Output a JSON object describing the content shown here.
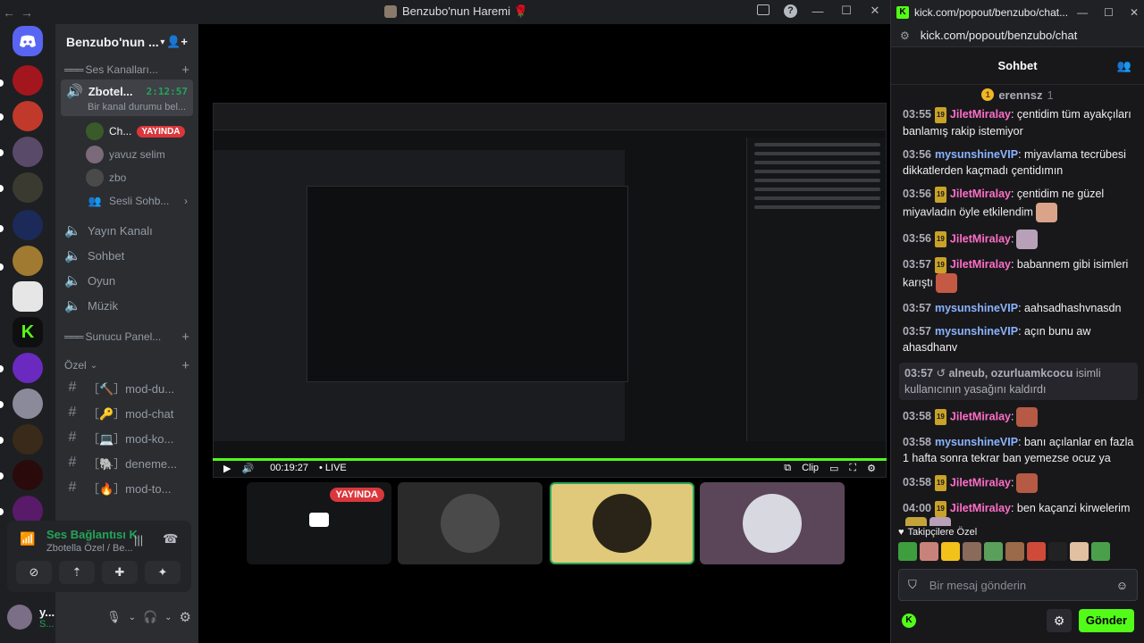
{
  "discord": {
    "window_title": "Benzubo'nun Haremi 🌹",
    "guild_name": "Benzubo'nun ...",
    "categories": {
      "voice": "Ses Kanalları...",
      "server_panel": "Sunucu Panel...",
      "private": "Özel"
    },
    "active_channel": {
      "name": "Zbotel...",
      "timer": "2:12:57",
      "status": "Bir kanal durumu bel..."
    },
    "members": [
      {
        "name": "Ch...",
        "badge": "YAYINDA"
      },
      {
        "name": "yavuz selim"
      },
      {
        "name": "zbo"
      }
    ],
    "subchannel": "Sesli Sohb...",
    "voice_channels": [
      "Yayın Kanalı",
      "Sohbet",
      "Oyun",
      "Müzik"
    ],
    "text_channels": [
      "［🔨］mod-du...",
      "［🔑］mod-chat",
      "［💻］mod-ko...",
      "［🐘］deneme...",
      "［🔥］mod-to..."
    ],
    "voice_panel": {
      "title": "Ses Bağlantısı K",
      "subtitle": "Zbotella Özel / Be..."
    },
    "user": {
      "name": "y...",
      "status": "S..."
    },
    "stream": {
      "time": "00:19:27",
      "live_label": "• LIVE",
      "clip_label": "Clip"
    },
    "tiles": {
      "live_label": "YAYINDA"
    }
  },
  "kick": {
    "window_title": "kick.com/popout/benzubo/chat...",
    "url": "kick.com/popout/benzubo/chat",
    "header": "Sohbet",
    "pinned_user": "erennsz",
    "pinned_count": "1",
    "messages": [
      {
        "ts": "03:55",
        "badge": "19",
        "user": "JiletMiralay",
        "color": "pink",
        "text": ": çentidim tüm ayakçıları banlamış rakip istemiyor"
      },
      {
        "ts": "03:56",
        "user": "mysunshineVIP",
        "color": "blue",
        "text": ": miyavlama tecrübesi dikkatlerden kaçmadı çentidımın"
      },
      {
        "ts": "03:56",
        "badge": "19",
        "user": "JiletMiralay",
        "color": "pink",
        "text": ": çentidim ne güzel miyavladın öyle etkilendim",
        "emote": "#d9a48a"
      },
      {
        "ts": "03:56",
        "badge": "19",
        "user": "JiletMiralay",
        "color": "pink",
        "text": ":",
        "emote": "#b8a0b8"
      },
      {
        "ts": "03:57",
        "badge": "19",
        "user": "JiletMiralay",
        "color": "pink",
        "text": ": babannem gibi isimleri karıştı",
        "emote": "#c55a44"
      },
      {
        "ts": "03:57",
        "user": "mysunshineVIP",
        "color": "blue",
        "text": ": aahsadhashvnasdn"
      },
      {
        "ts": "03:57",
        "user": "mysunshineVIP",
        "color": "blue",
        "text": ": açın bunu aw ahasdhanv"
      }
    ],
    "system_message": {
      "ts": "03:57",
      "users": "alneub, ozurluamkcocu",
      "text": " isimli kullanıcının yasağını kaldırdı"
    },
    "messages2": [
      {
        "ts": "03:58",
        "badge": "19",
        "user": "JiletMiralay",
        "color": "pink",
        "text": ":",
        "emote": "#b45a45"
      },
      {
        "ts": "03:58",
        "user": "mysunshineVIP",
        "color": "blue",
        "text": ": banı açılanlar en fazla 1 hafta sonra tekrar ban yemezse ocuz ya"
      },
      {
        "ts": "03:58",
        "badge": "19",
        "user": "JiletMiralay",
        "color": "pink",
        "text": ":",
        "emote": "#b45a45"
      },
      {
        "ts": "04:00",
        "badge": "19",
        "user": "JiletMiralay",
        "color": "pink",
        "text": ": ben kaçanzi kirwelerim",
        "emote": "#c4a43a"
      }
    ],
    "emote_section_label": "Takipçilere Özel",
    "emote_colors": [
      "#3e9e3e",
      "#c9827a",
      "#f2c21b",
      "#8a6a5a",
      "#5aa05a",
      "#9a6a4a",
      "#d04a3a",
      "#222222",
      "#e0c0a0",
      "#4aa04a"
    ],
    "input_placeholder": "Bir mesaj gönderin",
    "send_label": "Gönder"
  }
}
